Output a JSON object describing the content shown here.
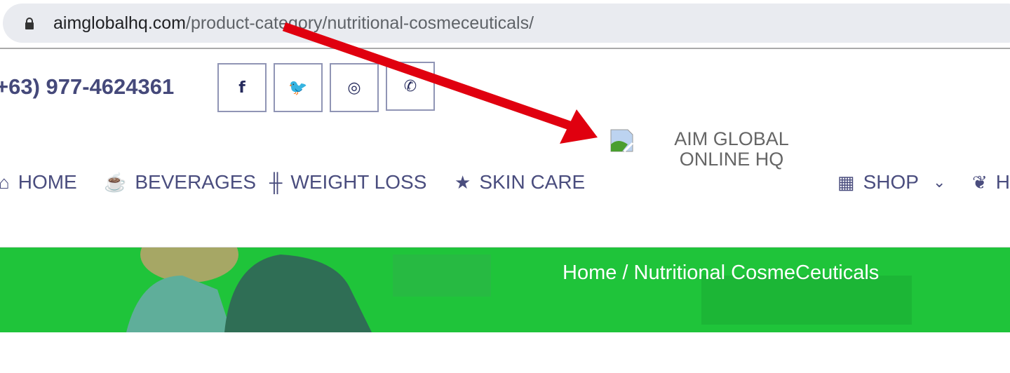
{
  "browser": {
    "url_host": "aimglobalhq.com",
    "url_path": "/product-category/nutritional-cosmeceuticals/"
  },
  "header": {
    "phone": "+63) 977-4624361",
    "social": [
      {
        "icon": "facebook-icon",
        "glyph": "f"
      },
      {
        "icon": "twitter-icon",
        "glyph": "🐦"
      },
      {
        "icon": "instagram-icon",
        "glyph": "◎"
      },
      {
        "icon": "whatsapp-icon",
        "glyph": "✆"
      }
    ],
    "logo_alt": "AIM GLOBAL ONLINE HQ"
  },
  "nav": {
    "items": [
      {
        "label": "HOME",
        "icon": "home-icon",
        "glyph": "⌂"
      },
      {
        "label": "BEVERAGES",
        "icon": "mug-icon",
        "glyph": "☕"
      },
      {
        "label": "WEIGHT LOSS",
        "icon": "dumbbell-icon",
        "glyph": "╫"
      },
      {
        "label": "SKIN CARE",
        "icon": "star-icon",
        "glyph": "★"
      },
      {
        "label": "SHOP",
        "icon": "store-icon",
        "glyph": "▦"
      },
      {
        "label": "H",
        "icon": "leaf-icon",
        "glyph": "❦"
      }
    ],
    "dropdown_glyph": "⌄"
  },
  "banner": {
    "breadcrumb": "Home / Nutritional CosmeCeuticals"
  },
  "colors": {
    "nav": "#4a4d7e",
    "banner": "#1fc43a",
    "arrow": "#e0000f"
  }
}
